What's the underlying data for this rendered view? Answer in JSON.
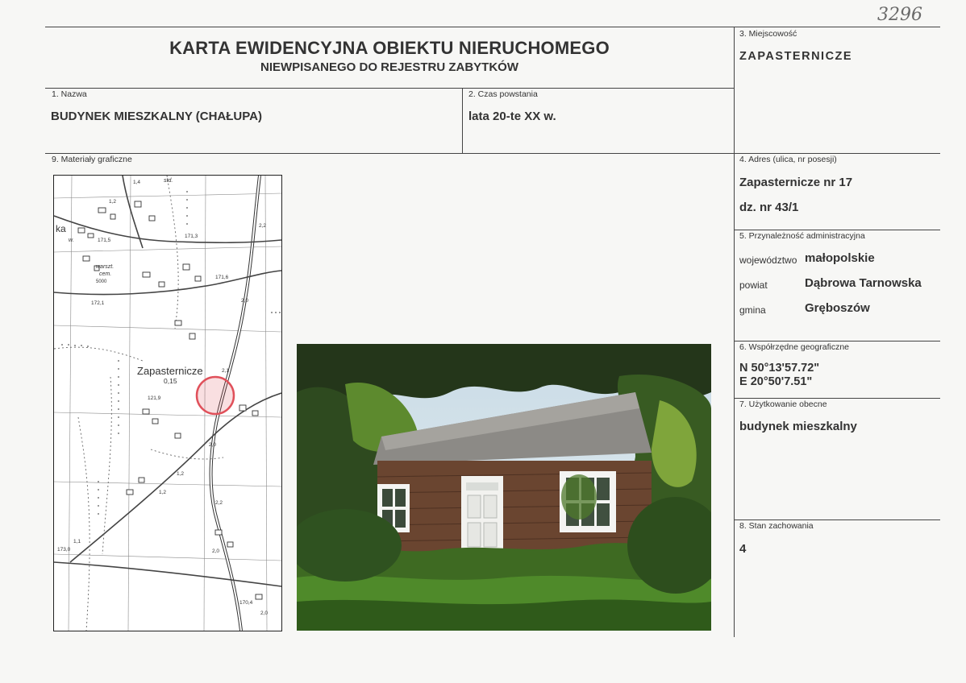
{
  "document": {
    "handwritten_number": "3296",
    "title": "KARTA EWIDENCYJNA OBIEKTU NIERUCHOMEGO",
    "subtitle": "NIEWPISANEGO DO REJESTRU ZABYTKÓW"
  },
  "fields": {
    "nazwa": {
      "label": "1. Nazwa",
      "value": "BUDYNEK MIESZKALNY (CHAŁUPA)"
    },
    "czas": {
      "label": "2. Czas powstania",
      "value": "lata 20-te XX w."
    },
    "miejscowosc": {
      "label": "3. Miejscowość",
      "value": "ZAPASTERNICZE"
    },
    "adres": {
      "label": "4. Adres (ulica, nr posesji)",
      "line1": "Zapasternicze nr 17",
      "line2": "dz. nr 43/1"
    },
    "przynaleznosc": {
      "label": "5. Przynależność administracyjna",
      "wojewodztwo_key": "województwo",
      "wojewodztwo": "małopolskie",
      "powiat_key": "powiat",
      "powiat": "Dąbrowa Tarnowska",
      "gmina_key": "gmina",
      "gmina": "Gręboszów"
    },
    "wspolrzedne": {
      "label": "6. Współrzędne geograficzne",
      "n": "N 50°13'57.72\"",
      "e": "E 20°50'7.51\""
    },
    "uzytkowanie": {
      "label": "7. Użytkowanie obecne",
      "value": "budynek mieszkalny"
    },
    "stan": {
      "label": "8. Stan zachowania",
      "value": "4"
    },
    "materialy": {
      "label": "9. Materiały graficzne"
    }
  },
  "map": {
    "place_name": "Zapasternicze",
    "place_value": "0,15",
    "elevations": [
      "1,4",
      "1,2",
      "171,5",
      "171,3",
      "171,6",
      "172,1",
      "2,0",
      "2,1",
      "121,9",
      "1,2",
      "1,2",
      "2,2",
      "1,1",
      "173,0",
      "2,0",
      "170,4",
      "2,0",
      "2,0",
      "2,2"
    ],
    "text_ka": "ka",
    "text_std": "std.",
    "text_warszt": "warszt.",
    "text_cem": "cem.",
    "text_5000": "5000",
    "text_w": "w."
  },
  "colors": {
    "marker": "#e0505a",
    "ink": "#333333",
    "rule": "#444444"
  }
}
